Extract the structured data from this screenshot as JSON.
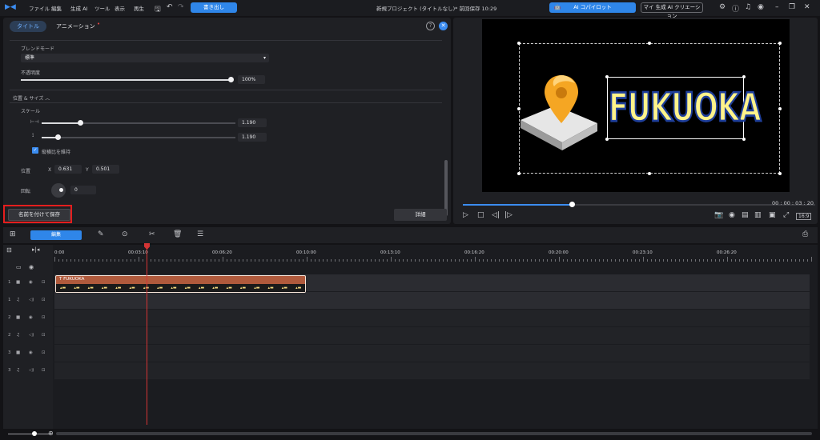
{
  "menubar": {
    "items": [
      "ファイル",
      "編集",
      "生成 AI",
      "ツール",
      "表示",
      "再生"
    ],
    "export_label": "書き出し",
    "project_title": "新規プロジェクト (タイトルなし)* 前回保存 10:29",
    "ai_copilot_label": "AI コパイロット",
    "ai_creation_label": "マイ 生成 AI クリエーション"
  },
  "left_panel": {
    "tab_title": "タイトル",
    "tab_animation": "アニメーション",
    "blend_mode_label": "ブレンドモード",
    "blend_mode_value": "標準",
    "opacity_label": "不透明度",
    "opacity_value": "100%",
    "opacity_level": 1.0,
    "pos_size_label": "位置 & サイズ",
    "scale_label": "スケール",
    "scale_w": "1.190",
    "scale_h": "1.190",
    "keep_ratio_label": "縦横比を維持",
    "position_label": "位置",
    "x_label": "X",
    "x_value": "0.631",
    "y_label": "Y",
    "y_value": "0.501",
    "rotation_label": "回転",
    "rotation_value": "0",
    "save_name_label": "名前を付けて保存",
    "detail_label": "詳細"
  },
  "preview": {
    "text": "FUKUOKA",
    "timecode": "00 : 00 : 03 : 20",
    "aspect": "16:9",
    "progress": 0.31
  },
  "timeline": {
    "edit_label": "編集",
    "ruler_labels": [
      "0:00",
      "00:03:10",
      "00:06:20",
      "00:10:00",
      "00:13:10",
      "00:16:20",
      "00:20:00",
      "00:23:10",
      "00:26:20"
    ],
    "clip_title": "FUKUOKA",
    "track_numbers": [
      "1",
      "1",
      "2",
      "2",
      "3",
      "3"
    ]
  },
  "colors": {
    "accent": "#2f86e9",
    "highlight": "#e41e1e",
    "clip": "#b05a3c"
  }
}
